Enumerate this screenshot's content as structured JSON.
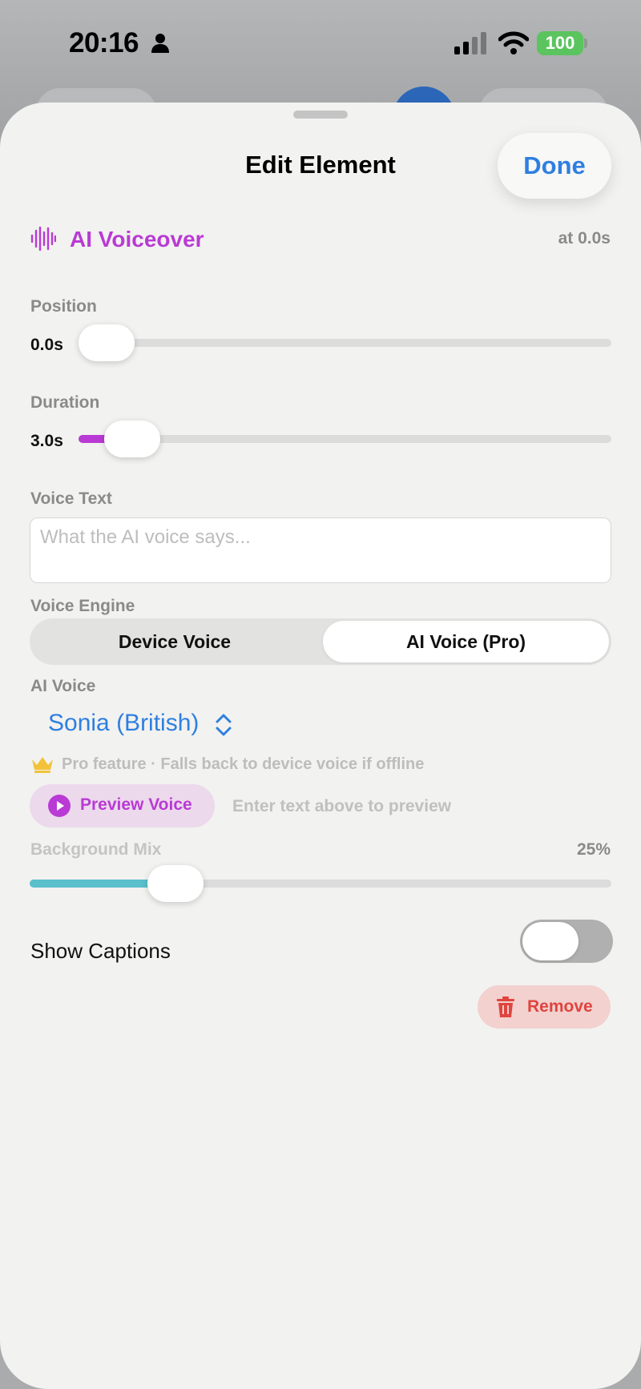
{
  "status_bar": {
    "time": "20:16",
    "battery": "100",
    "icons": [
      "person-icon",
      "signal-icon",
      "wifi-icon",
      "battery-icon"
    ]
  },
  "sheet": {
    "title": "Edit Element",
    "done_label": "Done"
  },
  "element": {
    "icon": "waveform-icon",
    "name": "AI Voiceover",
    "at": "at 0.0s"
  },
  "position": {
    "label": "Position",
    "value": "0.0s",
    "fraction": 0.0
  },
  "duration": {
    "label": "Duration",
    "value": "3.0s",
    "fraction": 0.1
  },
  "voice_text": {
    "label": "Voice Text",
    "value": "",
    "placeholder": "What the AI voice says..."
  },
  "voice_engine": {
    "label": "Voice Engine",
    "options": [
      "Device Voice",
      "AI Voice (Pro)"
    ],
    "selected": "AI Voice (Pro)"
  },
  "ai_voice": {
    "label": "AI Voice",
    "selected": "Sonia (British)"
  },
  "pro_note": "Pro feature · Falls back to device voice if offline",
  "preview": {
    "button_label": "Preview Voice",
    "hint": "Enter text above to preview"
  },
  "background_mix": {
    "label": "Background Mix",
    "value": "25%",
    "fraction": 0.25
  },
  "captions": {
    "label": "Show Captions",
    "enabled": false
  },
  "remove_label": "Remove",
  "colors": {
    "accent_purple": "#b93ad4",
    "accent_blue": "#2f7fe0",
    "mix_teal": "#5bbfcc",
    "danger": "#e0443e",
    "battery_green": "#5bc45f"
  }
}
